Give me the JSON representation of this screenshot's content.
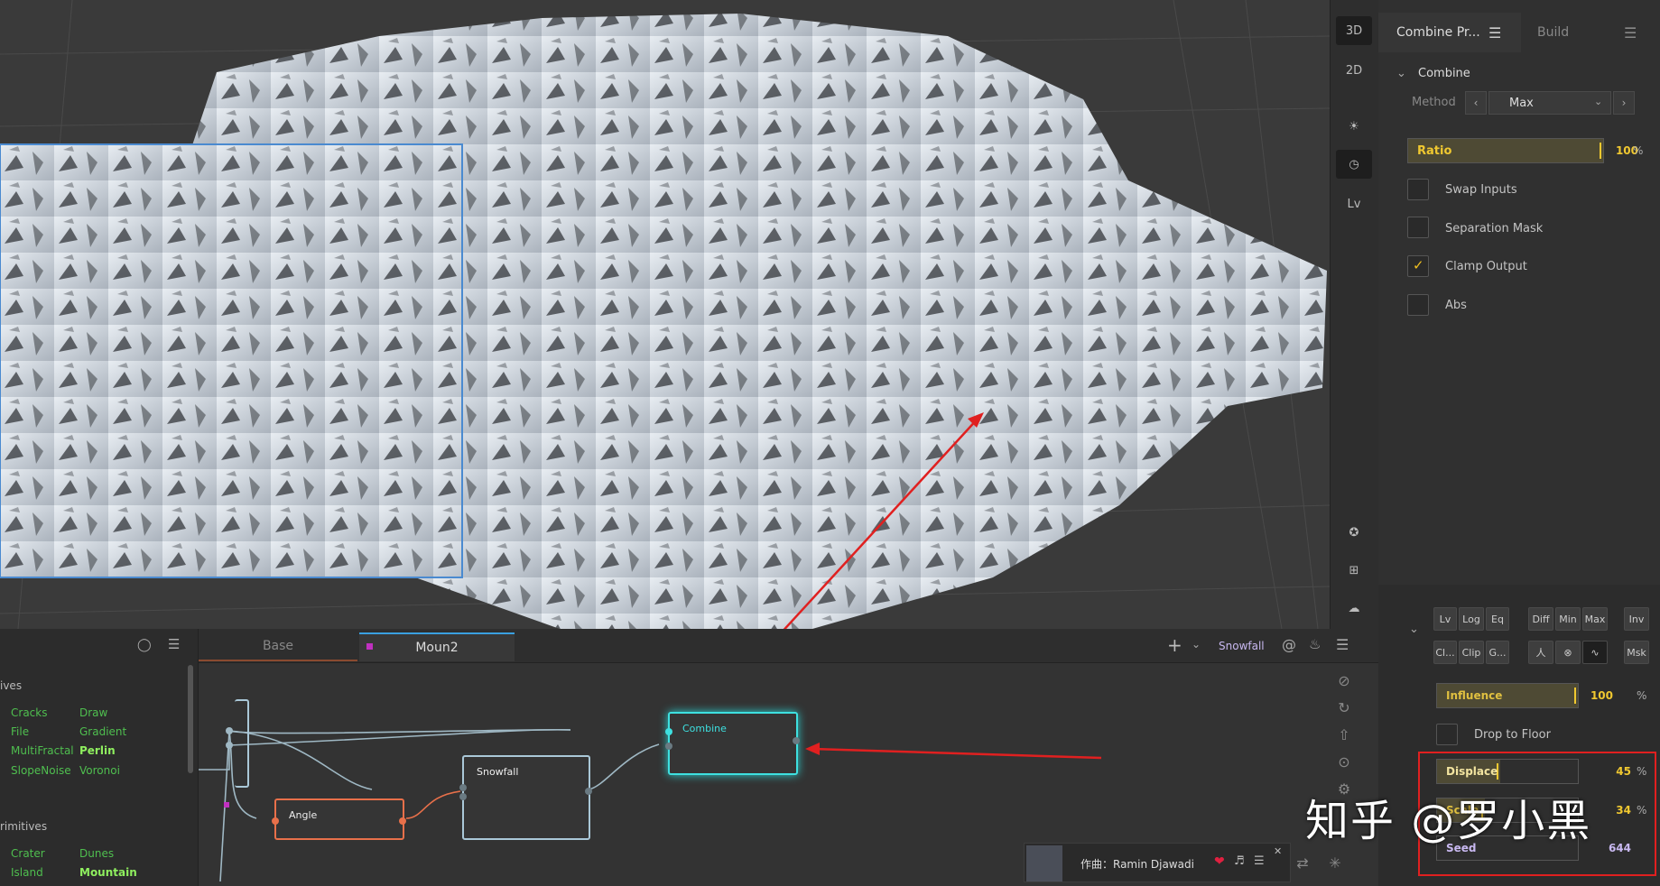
{
  "viewport": {
    "mode_3d": "3D",
    "mode_2d": "2D",
    "lv": "Lv"
  },
  "properties": {
    "tab_active": "Combine Pr...",
    "tab_build": "Build",
    "section": "Combine",
    "method_label": "Method",
    "method_value": "Max",
    "ratio": {
      "label": "Ratio",
      "value": "100",
      "unit": "%",
      "fraction": 1.0
    },
    "checkboxes": [
      {
        "label": "Swap Inputs",
        "checked": false
      },
      {
        "label": "Separation Mask",
        "checked": false
      },
      {
        "label": "Clamp Output",
        "checked": true
      },
      {
        "label": "Abs",
        "checked": false
      }
    ]
  },
  "mask_panel": {
    "row1": [
      "Lv",
      "Log",
      "Eq",
      "Diff",
      "Min",
      "Max",
      "Inv"
    ],
    "row2": [
      "Cl...",
      "Clip",
      "G...",
      "人",
      "⊗",
      "∿",
      "Msk"
    ],
    "influence": {
      "label": "Influence",
      "value": "100",
      "unit": "%",
      "fraction": 1.0
    },
    "drop_to_floor": "Drop to Floor",
    "displace": {
      "label": "Displace",
      "value": "45",
      "unit": "%",
      "fraction": 0.45
    },
    "scale": {
      "label": "Scale",
      "value": "34",
      "unit": "%",
      "fraction": 0.34
    },
    "seed": {
      "label": "Seed",
      "value": "644"
    }
  },
  "library": {
    "group1": "ives",
    "items1": [
      "Cracks",
      "Draw",
      "File",
      "Gradient",
      "MultiFractal",
      "Perlin",
      "SlopeNoise",
      "Voronoi"
    ],
    "group2": "rimitives",
    "items2": [
      "Crater",
      "Dunes",
      "Island",
      "Mountain"
    ]
  },
  "graph": {
    "tabs": [
      "Base",
      "Moun2"
    ],
    "active_tab": "Moun2",
    "build_target": "Snowfall",
    "nodes": {
      "combine": "Combine",
      "snowfall": "Snowfall",
      "angle": "Angle"
    }
  },
  "player": {
    "text": "作曲：Ramin Djawadi"
  },
  "watermark": "知乎 @罗小黑",
  "colors": {
    "accent": "#f0c830",
    "node_active": "#3ee0e0",
    "node_angle": "#e8704a",
    "annotation": "#e02020"
  }
}
